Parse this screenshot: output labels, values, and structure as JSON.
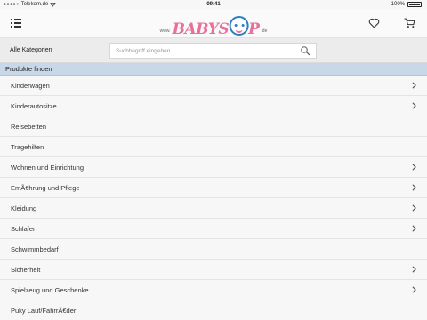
{
  "status_bar": {
    "carrier": "Telekom.de",
    "time": "09:41",
    "battery": "100%"
  },
  "header": {
    "logo_www": "www.",
    "logo_brand_left": "BABYS",
    "logo_brand_right": "P",
    "logo_tld": ".de",
    "menu_icon": "list-menu-icon",
    "wishlist_icon": "heart-icon",
    "cart_icon": "cart-icon"
  },
  "search": {
    "categories_label": "Alle Kategorien",
    "placeholder": "Suchbegriff eingeben ...",
    "value": ""
  },
  "section": {
    "title": "Produkte finden"
  },
  "categories": [
    {
      "label": "Kinderwagen",
      "has_children": true
    },
    {
      "label": "Kinderautositze",
      "has_children": true
    },
    {
      "label": "Reisebetten",
      "has_children": false
    },
    {
      "label": "Tragehilfen",
      "has_children": false
    },
    {
      "label": "Wohnen und Einrichtung",
      "has_children": true
    },
    {
      "label": "EmÃ€hrung und Pflege",
      "has_children": true
    },
    {
      "label": "Kleidung",
      "has_children": true
    },
    {
      "label": "Schlafen",
      "has_children": true
    },
    {
      "label": "Schwimmbedarf",
      "has_children": false
    },
    {
      "label": "Sicherheit",
      "has_children": true
    },
    {
      "label": "Spielzeug und Geschenke",
      "has_children": true
    },
    {
      "label": "Puky Lauf/FahrrÃ€der",
      "has_children": false
    }
  ]
}
